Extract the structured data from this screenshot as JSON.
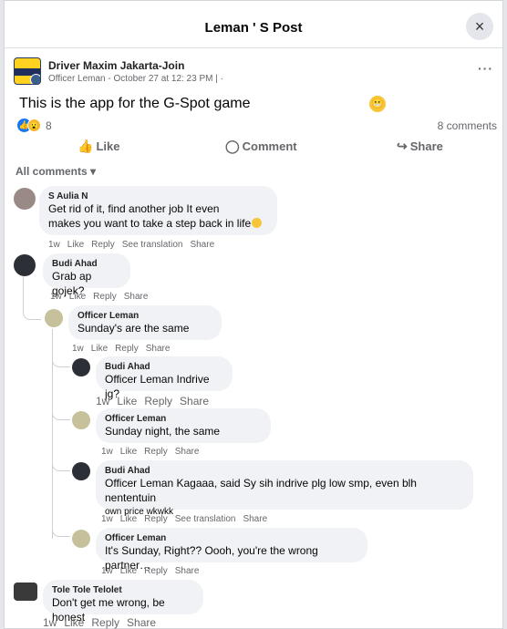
{
  "dialog": {
    "title": "Leman ' S Post",
    "close_icon": "×"
  },
  "post": {
    "author": "Driver Maxim Jakarta-Join",
    "meta": "Officer Leman - October 27 at 12: 23 PM | ·",
    "more": "···",
    "text": "This is the app for the G-Spot game",
    "reaction_count": "8",
    "comments_count": "8 comments"
  },
  "actions": {
    "like": "Like",
    "comment": "Comment",
    "share": "Share"
  },
  "filter": "All comments ▾",
  "comments": [
    {
      "name": "S Aulia N",
      "lines": [
        "Get rid of it, find another job It even",
        "makes you want to take a step back in life"
      ],
      "actions": [
        "1w",
        "Like",
        "Reply",
        "See translation",
        "Share"
      ]
    },
    {
      "name": "Budi Ahad",
      "lines": [
        "Grab ap gojek?"
      ],
      "actions": [
        "1w",
        "Like",
        "Reply",
        "Share"
      ]
    },
    {
      "name": "Officer Leman",
      "lines": [
        "Sunday's are the same"
      ],
      "actions": [
        "1w",
        "Like",
        "Reply",
        "Share"
      ]
    },
    {
      "name": "Budi Ahad",
      "lines": [
        "Officer Leman Indrive jg?"
      ],
      "actions": [
        "1w",
        "Like",
        "Reply",
        "Share"
      ]
    },
    {
      "name": "Officer Leman",
      "lines": [
        "Sunday night, the same"
      ],
      "actions": [
        "1w",
        "Like",
        "Reply",
        "Share"
      ]
    },
    {
      "name": "Budi Ahad",
      "lines": [
        "Officer Leman Kagaaa, said Sy sih indrive plg low smp, even blh nententuin",
        "own price wkwkk"
      ],
      "actions": [
        "1w",
        "Like",
        "Reply",
        "See translation",
        "Share"
      ]
    },
    {
      "name": "Officer Leman",
      "lines": [
        "It's Sunday, Right?? Oooh, you're the wrong partner…"
      ],
      "actions": [
        "1w",
        "Like",
        "Reply",
        "Share"
      ]
    },
    {
      "name": "Tole Tole Telolet",
      "lines": [
        "Don't get me wrong, be honest"
      ],
      "actions": [
        "1w",
        "Like",
        "Reply",
        "Share"
      ]
    }
  ],
  "colors": {
    "accent": "#1877f2",
    "bubble": "#f0f2f5",
    "muted": "#65676b"
  }
}
